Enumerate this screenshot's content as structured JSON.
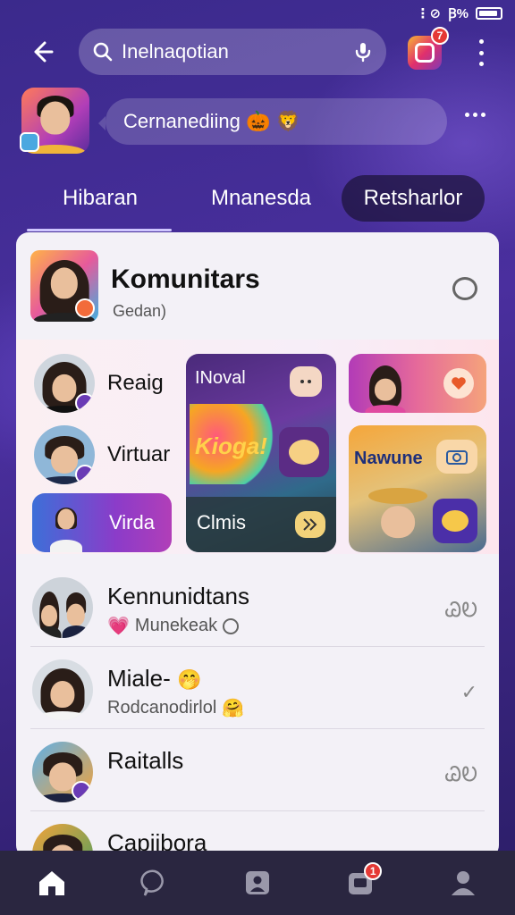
{
  "status_bar": {
    "icons": "⋮⊘ 𝄐 ▯",
    "text": "Ꞵ%"
  },
  "search": {
    "placeholder": "Inelnaqotian"
  },
  "header": {
    "notification_count": "7"
  },
  "profile": {
    "status_text": "Cernanediing 🎃 🦁"
  },
  "tabs": [
    {
      "label": "Hibaran"
    },
    {
      "label": "Mnanesda"
    },
    {
      "label": "Retsharlor"
    }
  ],
  "community": {
    "title": "Komunitars",
    "subtitle": "Gedan)"
  },
  "grid": {
    "left": [
      {
        "label": "Reaig"
      },
      {
        "label": "Virtuar"
      },
      {
        "label": "Virda"
      }
    ],
    "center": {
      "top_label": "INoval",
      "art_text": "Kioga!",
      "bottom_label": "Clmis"
    },
    "right": {
      "art_text": "Nawune"
    }
  },
  "list": [
    {
      "title": "Kennunidtans",
      "subtitle": "Munekeak",
      "emoji": "💗",
      "tick": "ᏊᎧ"
    },
    {
      "title": "Miale-",
      "subtitle": "Rodcanodirlol",
      "emoji": "🤭",
      "tick": "✓"
    },
    {
      "title": "Raitalls",
      "subtitle": "",
      "emoji": "",
      "tick": "ᏊᎧ"
    },
    {
      "title": "Capiibora",
      "subtitle": "",
      "emoji": "",
      "tick": "✓"
    }
  ],
  "bottom_nav": {
    "inbox_badge": "1"
  },
  "colors": {
    "accent": "#4a2f9e",
    "card": "#f3f1f7",
    "nav": "#2a2640",
    "badge": "#e53935"
  }
}
